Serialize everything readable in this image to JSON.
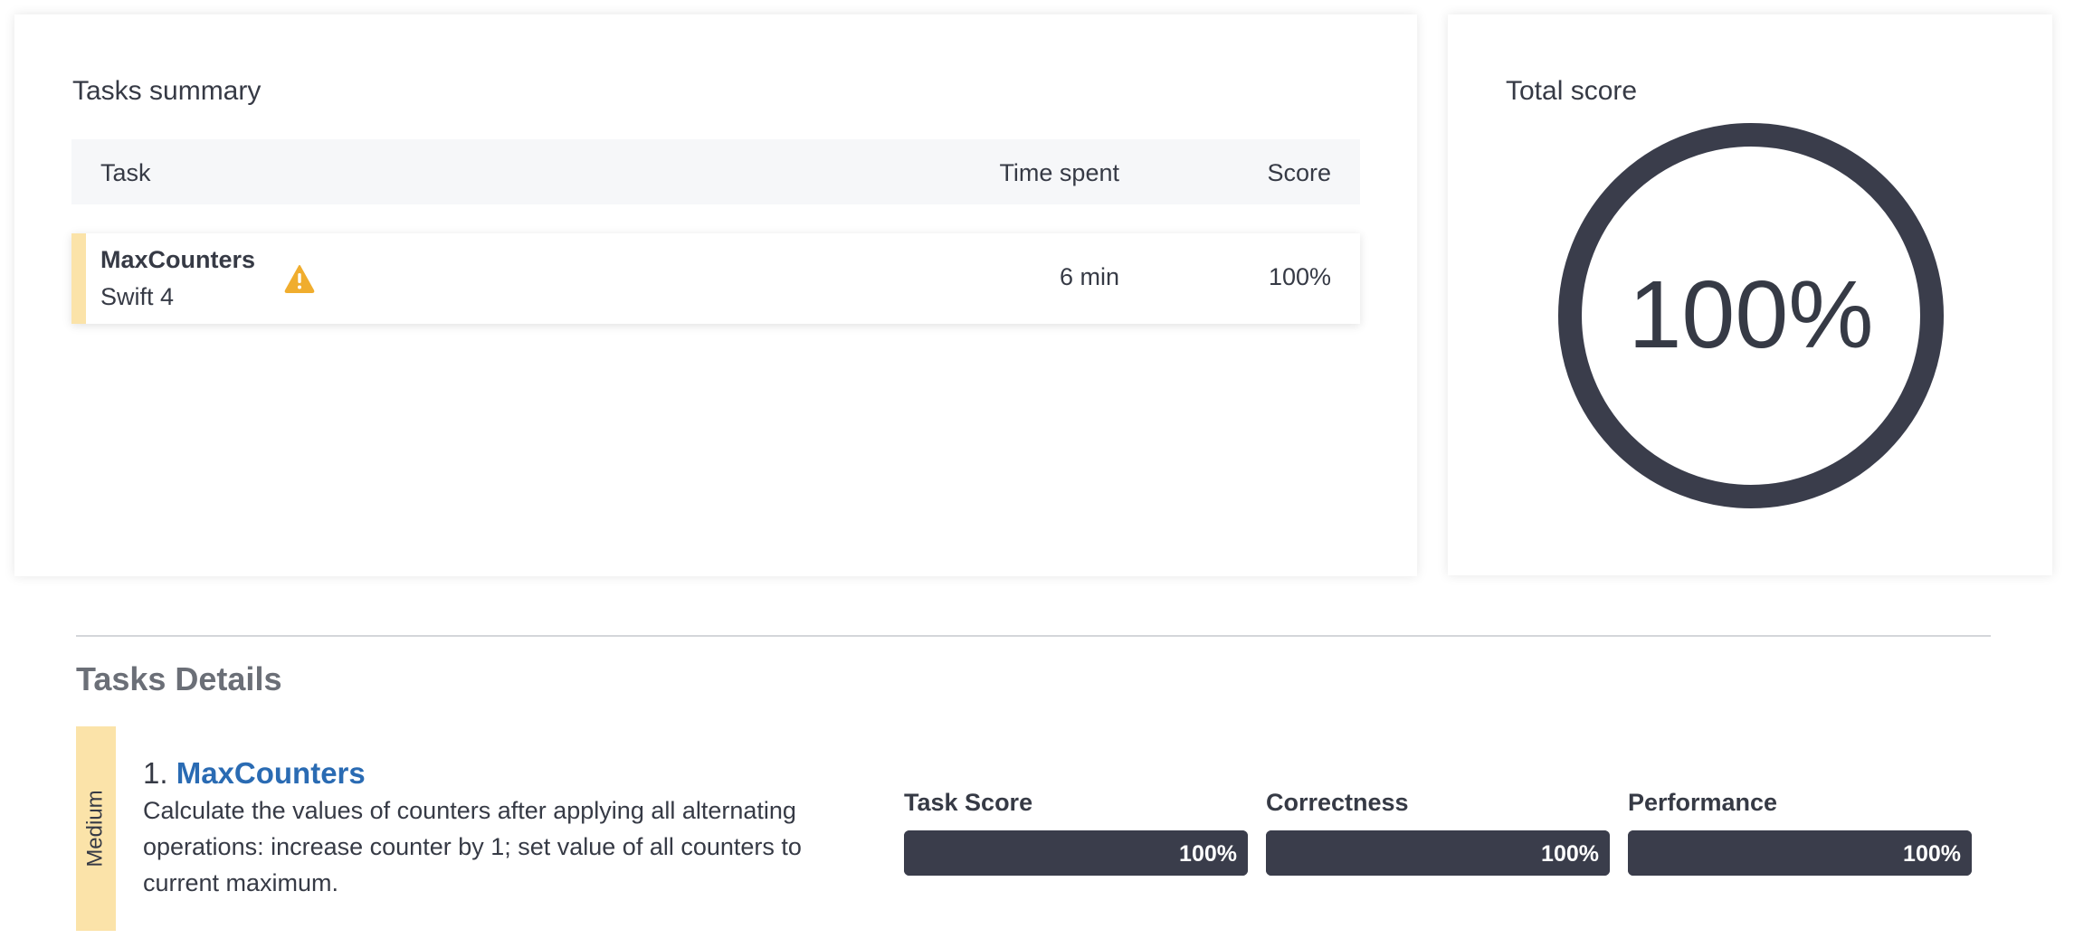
{
  "summary": {
    "title": "Tasks summary",
    "columns": {
      "task": "Task",
      "time": "Time spent",
      "score": "Score"
    },
    "rows": [
      {
        "name": "MaxCounters",
        "language": "Swift 4",
        "time": "6 min",
        "score": "100%",
        "warning_icon": "warning-triangle-icon"
      }
    ]
  },
  "total": {
    "title": "Total score",
    "value": "100%",
    "fraction": 1.0
  },
  "details": {
    "title": "Tasks Details",
    "tasks": [
      {
        "difficulty": "Medium",
        "number": "1.",
        "name": "MaxCounters",
        "description": "Calculate the values of counters after applying all alternating operations: increase counter by 1; set value of all counters to current maximum.",
        "metrics": [
          {
            "label": "Task Score",
            "value": "100%",
            "fraction": 1.0
          },
          {
            "label": "Correctness",
            "value": "100%",
            "fraction": 1.0
          },
          {
            "label": "Performance",
            "value": "100%",
            "fraction": 1.0
          }
        ]
      }
    ]
  },
  "colors": {
    "accent_difficulty": "#fbe3a9",
    "bar": "#3a3d4b",
    "link": "#2a6bb3",
    "warning": "#f0ad2e"
  }
}
